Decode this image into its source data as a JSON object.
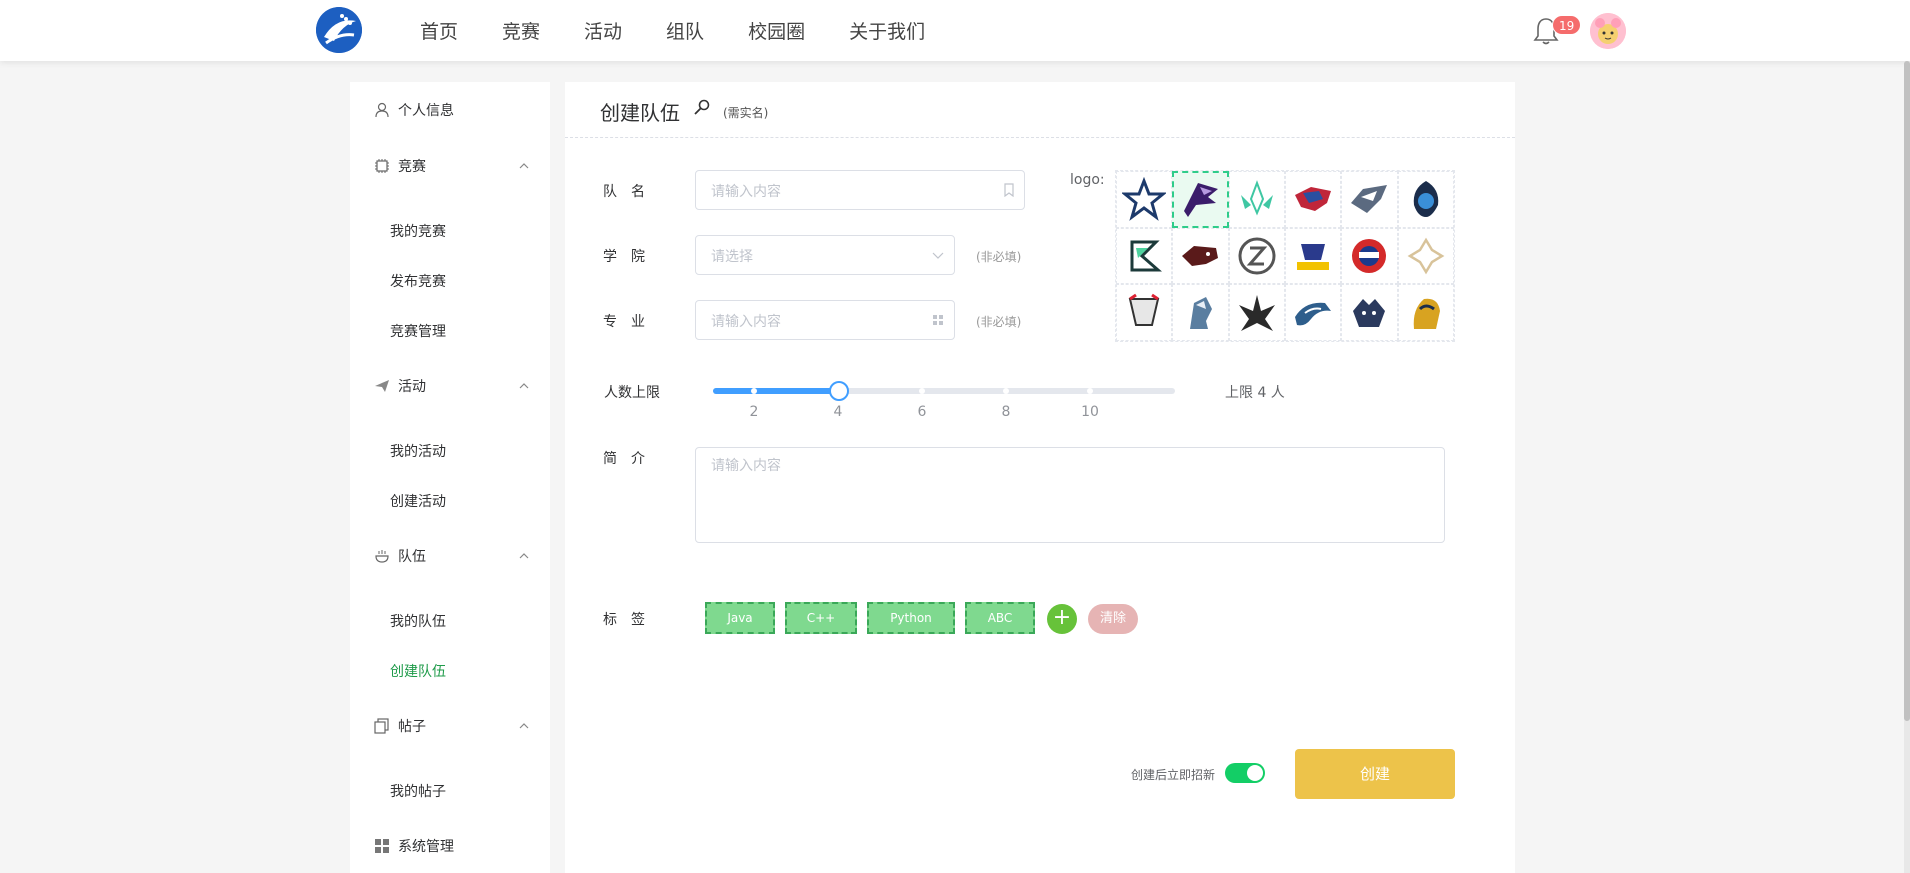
{
  "header": {
    "nav": [
      "首页",
      "竞赛",
      "活动",
      "组队",
      "校园圈",
      "关于我们"
    ],
    "notification_count": "19"
  },
  "sidebar": {
    "personal": "个人信息",
    "competition": {
      "label": "竞赛",
      "items": [
        "我的竞赛",
        "发布竞赛",
        "竞赛管理"
      ]
    },
    "activity": {
      "label": "活动",
      "items": [
        "我的活动",
        "创建活动"
      ]
    },
    "team": {
      "label": "队伍",
      "items": [
        "我的队伍",
        "创建队伍"
      ]
    },
    "post": {
      "label": "帖子",
      "items": [
        "我的帖子"
      ]
    },
    "system": "系统管理"
  },
  "form": {
    "title": "创建队伍",
    "title_note": "(需实名)",
    "team_name": {
      "label": "队　名",
      "placeholder": "请输入内容"
    },
    "college": {
      "label": "学　院",
      "placeholder": "请选择",
      "note": "(非必填)"
    },
    "major": {
      "label": "专　业",
      "placeholder": "请输入内容",
      "note": "(非必填)"
    },
    "logo_label": "logo:",
    "logo_count": 18,
    "logo_selected_index": 1,
    "member_limit": {
      "label": "人数上限",
      "value": 4,
      "min": 1,
      "max": 12,
      "ticks": [
        "2",
        "4",
        "6",
        "8",
        "10"
      ],
      "text": "上限 4 人"
    },
    "intro": {
      "label": "简　介",
      "placeholder": "请输入内容"
    },
    "tags": {
      "label": "标　签",
      "items": [
        "Java",
        "C++",
        "Python",
        "ABC"
      ],
      "add": "+",
      "clear": "清除"
    },
    "recruit_switch": {
      "label": "创建后立即招新",
      "on": true
    },
    "submit": "创建"
  },
  "colors": {
    "accent_green": "#1f9b4a",
    "slider_blue": "#409eff",
    "tag_green": "#7fd98f",
    "button_yellow": "#edc34a",
    "switch_green": "#13ce66",
    "badge_red": "#f56c6c"
  }
}
